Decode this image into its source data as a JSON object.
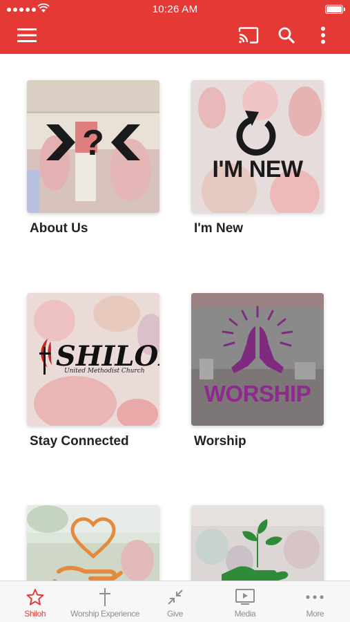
{
  "status_bar": {
    "time": "10:26 AM"
  },
  "app_bar": {
    "icons": [
      "hamburger-menu-icon",
      "cast-icon",
      "search-icon",
      "more-vert-icon"
    ],
    "color": "#e53935"
  },
  "tiles": [
    {
      "label": "About Us",
      "art_text": "?"
    },
    {
      "label": "I'm New",
      "art_text": "I'M NEW"
    },
    {
      "label": "Stay Connected",
      "art_text": "SHILOH",
      "art_subtext": "United Methodist Church"
    },
    {
      "label": "Worship",
      "art_text": "WORSHIP"
    },
    {
      "label": "",
      "art_text": ""
    },
    {
      "label": "",
      "art_text": ""
    }
  ],
  "tab_bar": {
    "active_color": "#e53935",
    "tabs": [
      {
        "label": "Shiloh",
        "icon": "star-icon",
        "active": true
      },
      {
        "label": "Worship Experience",
        "icon": "cross-icon",
        "active": false
      },
      {
        "label": "Give",
        "icon": "collapse-arrows-icon",
        "active": false
      },
      {
        "label": "Media",
        "icon": "tv-play-icon",
        "active": false
      },
      {
        "label": "More",
        "icon": "more-horiz-icon",
        "active": false
      }
    ]
  }
}
